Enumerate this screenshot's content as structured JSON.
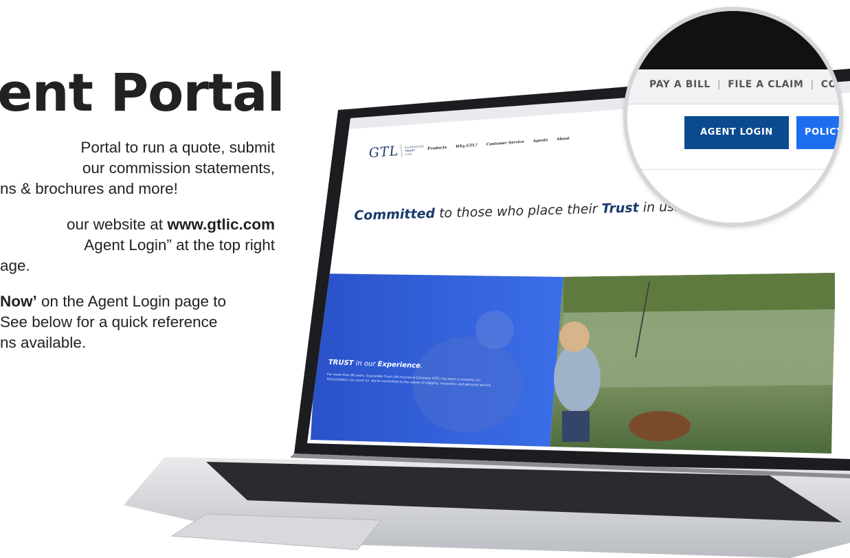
{
  "page": {
    "title": "ent Portal",
    "paragraphs": [
      {
        "lines": [
          "Portal to run a quote, submit",
          "our commission statements,",
          "ns & brochures and more!"
        ]
      },
      {
        "lines_pre": [
          "our website at "
        ],
        "bold_url": "www.gtlic.com",
        "lines": [
          "Agent Login” at the top right",
          "age."
        ]
      },
      {
        "bold_lead": "Now’",
        "lead_rest": " on the Agent Login page to",
        "lines": [
          "See below for a quick reference",
          "ns available."
        ]
      }
    ]
  },
  "website": {
    "logo": {
      "text": "GTL",
      "sub1": "GUARANTEE",
      "sub2": "TRUST",
      "sub3": "LIFE"
    },
    "nav": [
      "Products",
      "Why GTL?",
      "Customer Service",
      "Agents",
      "About"
    ],
    "tagline": {
      "bold1": "Committed",
      "mid": " to those who place their ",
      "bold2": "Trust",
      "end": " in us."
    },
    "hero": {
      "heading_bold": "TRUST",
      "heading_mid": " in our ",
      "heading_bold2": "Experience",
      "heading_end": ".",
      "body": "For more than 80 years, Guarantee Trust Life Insurance Company (GTL) has been a company our Policyholders can count on. We're committed to the values of integrity, innovation and personal service."
    }
  },
  "magnifier": {
    "utility_links": [
      "PAY A BILL",
      "FILE A CLAIM",
      "CON"
    ],
    "agent_login": "AGENT LOGIN",
    "policy_button": "POLICY"
  },
  "colors": {
    "agent_button": "#0c4a8f",
    "policy_button": "#1e6ff0",
    "hero_blue": "#1f4fc2"
  }
}
